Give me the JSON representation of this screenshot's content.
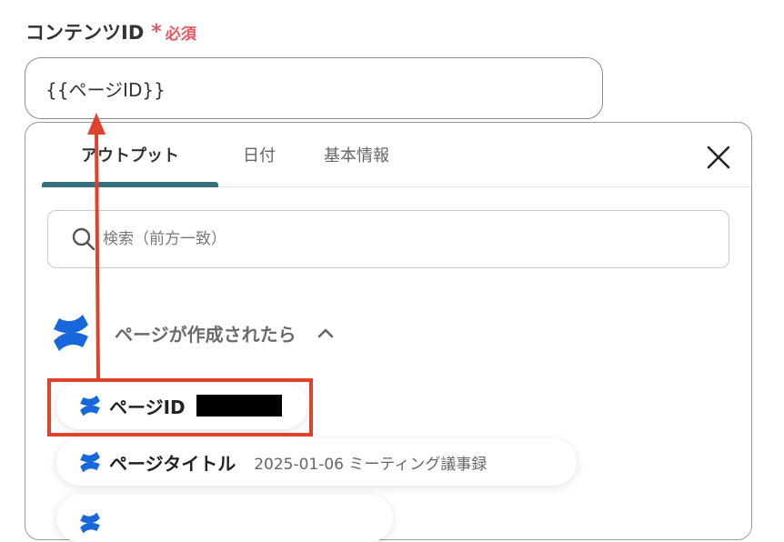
{
  "field": {
    "label": "コンテンツID",
    "required_star": "*",
    "required_text": "必須",
    "value": "{{ページID}}"
  },
  "tabs": [
    {
      "label": "アウトプット",
      "active": true
    },
    {
      "label": "日付",
      "active": false
    },
    {
      "label": "基本情報",
      "active": false
    }
  ],
  "search": {
    "placeholder": "検索（前方一致）",
    "icon": "search-icon"
  },
  "group": {
    "title": "ページが作成されたら",
    "icon": "confluence-logo-icon",
    "toggle_icon": "chevron-up-icon"
  },
  "items": [
    {
      "label": "ページID",
      "value": "",
      "redacted": true
    },
    {
      "label": "ページタイトル",
      "value": "2025-01-06 ミーティング議事録"
    },
    {
      "label": "",
      "value": ""
    }
  ],
  "colors": {
    "required": "#e85562",
    "tab_active": "#34707e",
    "annotation": "#e0432b",
    "confluence_blue": "#1868db"
  }
}
